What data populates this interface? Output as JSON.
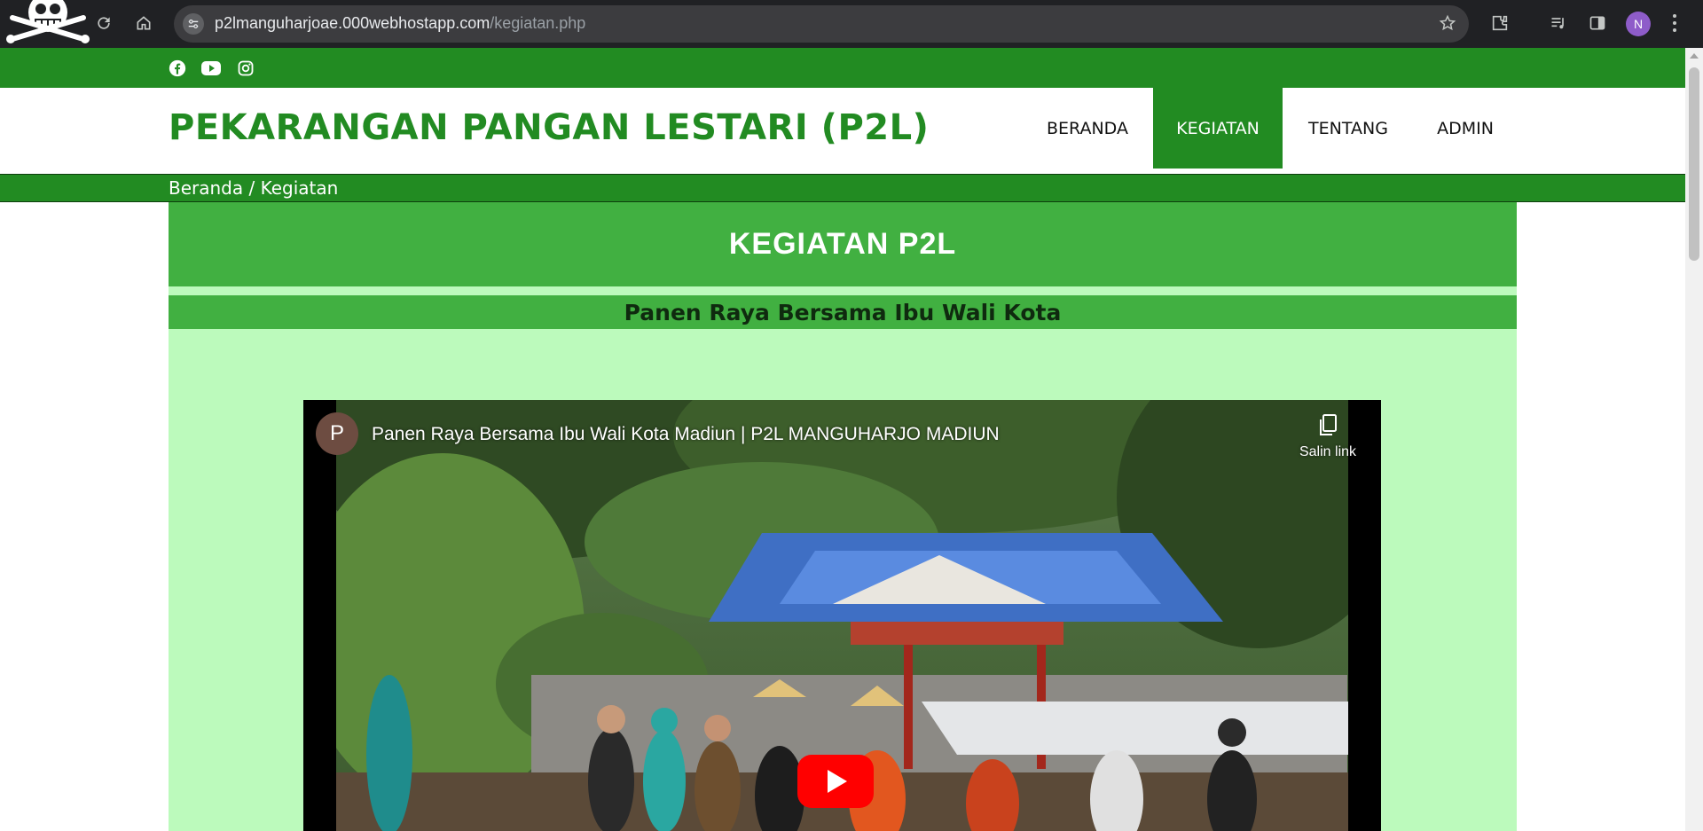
{
  "browser": {
    "url_host": "p2lmanguharjoae.000webhostapp.com",
    "url_path": "/kegiatan.php",
    "profile_initial": "N"
  },
  "topbar": {
    "social": [
      "facebook-icon",
      "youtube-icon",
      "instagram-icon"
    ],
    "color": "#228b22"
  },
  "header": {
    "brand": "PEKARANGAN PANGAN LESTARI (P2L)",
    "menu": [
      {
        "label": "BERANDA",
        "active": false
      },
      {
        "label": "KEGIATAN",
        "active": true
      },
      {
        "label": "TENTANG",
        "active": false
      },
      {
        "label": "ADMIN",
        "active": false
      }
    ]
  },
  "breadcrumb": "Beranda / Kegiatan",
  "main": {
    "title": "KEGIATAN P2L",
    "activity_title": "Panen Raya Bersama Ibu Wali Kota",
    "video": {
      "channel_initial": "P",
      "title": "Panen Raya Bersama Ibu Wali Kota Madiun | P2L MANGUHARJO MADIUN",
      "copy_link_label": "Salin link"
    }
  },
  "colors": {
    "primary_green": "#228b22",
    "band_green": "#41b041",
    "content_bg": "#bcfabc",
    "youtube_red": "#ff0000"
  }
}
